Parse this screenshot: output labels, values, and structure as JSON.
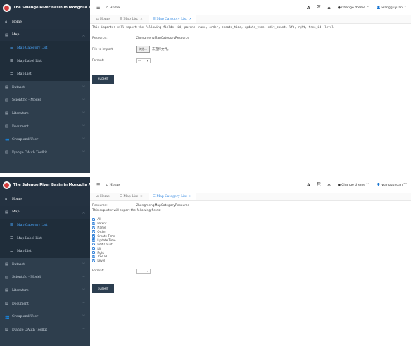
{
  "brand": {
    "title": "The Selenge River Basin in Mongolia Admin"
  },
  "sidebar": {
    "items": [
      {
        "label": "Home",
        "icon": "home-icon"
      },
      {
        "label": "Map",
        "icon": "list-icon"
      },
      {
        "label": "Map Category List",
        "icon": "list-icon"
      },
      {
        "label": "Map Label List",
        "icon": "list-icon"
      },
      {
        "label": "Map List",
        "icon": "list-icon"
      },
      {
        "label": "Dataset",
        "icon": "list-icon"
      },
      {
        "label": "Scientific - Model",
        "icon": "list-icon"
      },
      {
        "label": "Literature",
        "icon": "list-icon"
      },
      {
        "label": "Document",
        "icon": "list-icon"
      },
      {
        "label": "Group and User",
        "icon": "users-icon"
      },
      {
        "label": "Django OAuth Toolkit",
        "icon": "list-icon"
      }
    ]
  },
  "header": {
    "home_label": "Home",
    "theme_label": "Change theme",
    "user_label": "wangguyuan"
  },
  "tabs": [
    {
      "label": "Home"
    },
    {
      "label": "Map List"
    },
    {
      "label": "Map Category List"
    }
  ],
  "import_view": {
    "notice": "This importer will import the following fields: id, parent, name, order, create_time, update_time, edit_count, lft, rght, tree_id, level",
    "resource_label": "Resource:",
    "resource_value": "ZhongmengMapCategoryResource",
    "file_label": "File to import:",
    "browse_label": "浏览...",
    "no_file_label": "未选择文件。",
    "format_label": "Format:",
    "format_value": "---",
    "submit_label": "SUBMIT"
  },
  "export_view": {
    "resource_label": "Resource:",
    "resource_value": "ZhongmengMapCategoryResource",
    "notice": "This exporter will export the following fields:",
    "fields": [
      "All",
      "Parent",
      "Name",
      "Order",
      "Create Time",
      "Update Time",
      "Edit Count",
      "Lft",
      "Rght",
      "Tree Id",
      "Level"
    ],
    "format_label": "Format:",
    "format_value": "---",
    "submit_label": "SUBMIT"
  },
  "colors": {
    "sidebar_bg": "#2e3e4d",
    "accent": "#2f86e0",
    "submit_bg": "#2c3e50",
    "logo": "#d43b3b"
  }
}
